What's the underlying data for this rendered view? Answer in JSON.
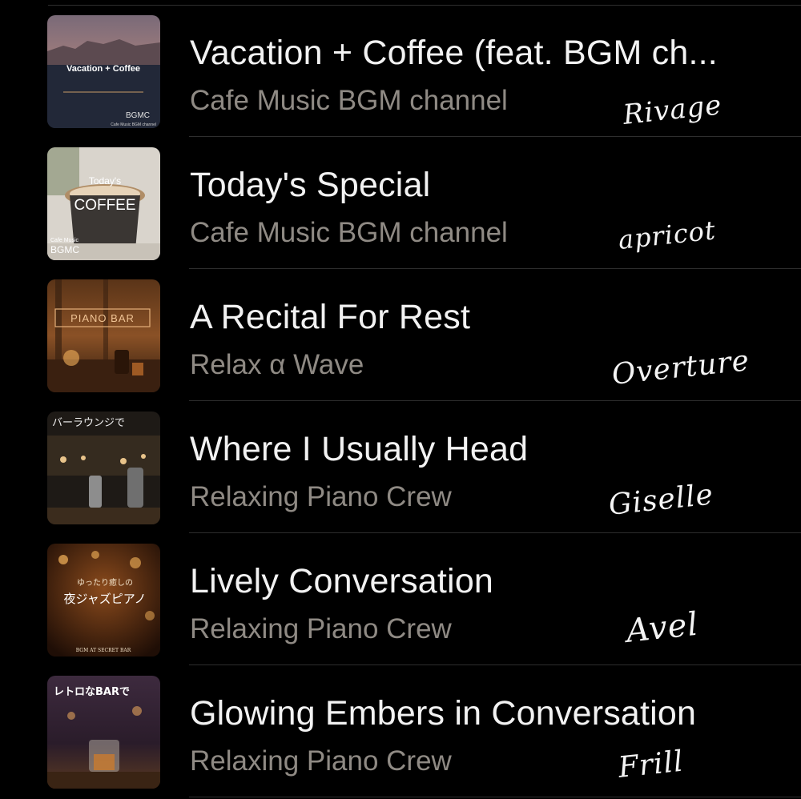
{
  "tracks": [
    {
      "title": "Vacation + Coffee (feat. BGM ch...",
      "artist": "Cafe Music BGM channel",
      "script_label": "Rivage",
      "artwork": {
        "icon": "harbor-city-cover",
        "text": "Vacation + Coffee",
        "sub": "BGMC",
        "small": "Cafe Music BGM channel"
      }
    },
    {
      "title": "Today's Special",
      "artist": "Cafe Music BGM channel",
      "script_label": "apricot",
      "artwork": {
        "icon": "coffee-cup-cover",
        "text": "Today's",
        "sub": "COFFEE",
        "small": "Cafe Music",
        "brand": "BGMC"
      }
    },
    {
      "title": "A Recital For Rest",
      "artist": "Relax α Wave",
      "script_label": "Overture",
      "artwork": {
        "icon": "piano-bar-cover",
        "text": "PIANO BAR"
      }
    },
    {
      "title": "Where I Usually Head",
      "artist": "Relaxing Piano Crew",
      "script_label": "Giselle",
      "artwork": {
        "icon": "lounge-bar-cover",
        "text": "バーラウンジで"
      }
    },
    {
      "title": "Lively Conversation",
      "artist": "Relaxing Piano Crew",
      "script_label": "Avel",
      "artwork": {
        "icon": "night-jazz-piano-cover",
        "text": "ゆったり癒しの",
        "sub": "夜ジャズピアノ",
        "small": "BGM AT SECRET BAR"
      }
    },
    {
      "title": "Glowing Embers in Conversation",
      "artist": "Relaxing Piano Crew",
      "script_label": "Frill",
      "artwork": {
        "icon": "retro-bar-cover",
        "text": "レトロなBARで"
      }
    }
  ],
  "colors": {
    "background": "#000000",
    "title": "#f2f2f2",
    "artist": "#8f8a84",
    "separator": "#2e2e2e"
  }
}
